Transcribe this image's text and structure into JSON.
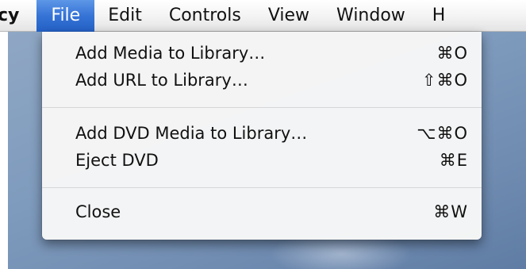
{
  "menubar": {
    "items": [
      {
        "label": "cy"
      },
      {
        "label": "File"
      },
      {
        "label": "Edit"
      },
      {
        "label": "Controls"
      },
      {
        "label": "View"
      },
      {
        "label": "Window"
      },
      {
        "label": "H"
      }
    ]
  },
  "file_menu": {
    "groups": [
      {
        "items": [
          {
            "label": "Add Media to Library…",
            "shortcut": "⌘O"
          },
          {
            "label": "Add URL to Library…",
            "shortcut": "⇧⌘O"
          }
        ]
      },
      {
        "items": [
          {
            "label": "Add DVD Media to Library…",
            "shortcut": "⌥⌘O"
          },
          {
            "label": "Eject DVD",
            "shortcut": "⌘E"
          }
        ]
      },
      {
        "items": [
          {
            "label": "Close",
            "shortcut": "⌘W"
          }
        ]
      }
    ]
  }
}
